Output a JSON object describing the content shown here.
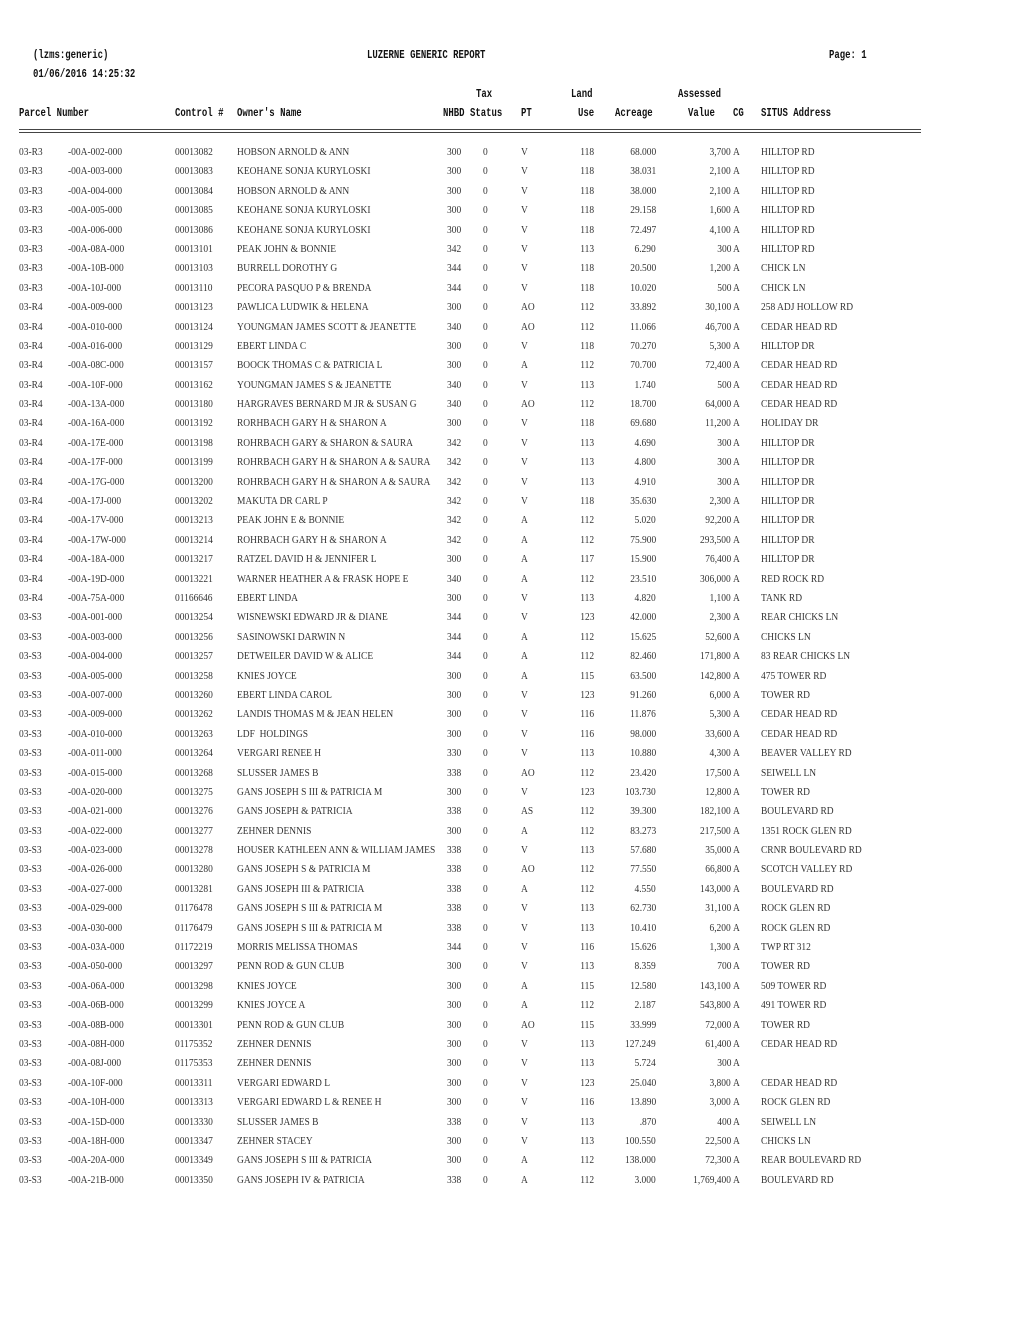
{
  "report": {
    "program": "(lzms:generic)",
    "title": "LUZERNE GENERIC REPORT",
    "page_label": "Page:",
    "page_number": "1",
    "run_datetime": "01/06/2016 14:25:32"
  },
  "columns": {
    "parcel_number": "Parcel Number",
    "control": "Control #",
    "owner": "Owner's Name",
    "nhbd": "NHBD",
    "tax_status_top": "Tax",
    "tax_status": "Status",
    "pt": "PT",
    "land_use_top": "Land",
    "land_use": "Use",
    "acreage": "Acreage",
    "assessed_value_top": "Assessed",
    "assessed_value": "Value",
    "cg": "CG",
    "situs": "SITUS Address"
  },
  "rows": [
    {
      "map": "03-R3",
      "parcel": "-00A-002-000",
      "control": "00013082",
      "owner": "HOBSON ARNOLD & ANN",
      "nhbd": "300",
      "status": "0",
      "pt": "V",
      "land_use": "118",
      "acreage": "68.000",
      "value": "3,700",
      "cg": "A",
      "situs": "HILLTOP RD"
    },
    {
      "map": "03-R3",
      "parcel": "-00A-003-000",
      "control": "00013083",
      "owner": "KEOHANE SONJA KURYLOSKI",
      "nhbd": "300",
      "status": "0",
      "pt": "V",
      "land_use": "118",
      "acreage": "38.031",
      "value": "2,100",
      "cg": "A",
      "situs": "HILLTOP RD"
    },
    {
      "map": "03-R3",
      "parcel": "-00A-004-000",
      "control": "00013084",
      "owner": "HOBSON ARNOLD & ANN",
      "nhbd": "300",
      "status": "0",
      "pt": "V",
      "land_use": "118",
      "acreage": "38.000",
      "value": "2,100",
      "cg": "A",
      "situs": "HILLTOP RD"
    },
    {
      "map": "03-R3",
      "parcel": "-00A-005-000",
      "control": "00013085",
      "owner": "KEOHANE SONJA KURYLOSKI",
      "nhbd": "300",
      "status": "0",
      "pt": "V",
      "land_use": "118",
      "acreage": "29.158",
      "value": "1,600",
      "cg": "A",
      "situs": "HILLTOP RD"
    },
    {
      "map": "03-R3",
      "parcel": "-00A-006-000",
      "control": "00013086",
      "owner": "KEOHANE SONJA KURYLOSKI",
      "nhbd": "300",
      "status": "0",
      "pt": "V",
      "land_use": "118",
      "acreage": "72.497",
      "value": "4,100",
      "cg": "A",
      "situs": "HILLTOP RD"
    },
    {
      "map": "03-R3",
      "parcel": "-00A-08A-000",
      "control": "00013101",
      "owner": "PEAK JOHN & BONNIE",
      "nhbd": "342",
      "status": "0",
      "pt": "V",
      "land_use": "113",
      "acreage": "6.290",
      "value": "300",
      "cg": "A",
      "situs": "HILLTOP RD"
    },
    {
      "map": "03-R3",
      "parcel": "-00A-10B-000",
      "control": "00013103",
      "owner": "BURRELL DOROTHY G",
      "nhbd": "344",
      "status": "0",
      "pt": "V",
      "land_use": "118",
      "acreage": "20.500",
      "value": "1,200",
      "cg": "A",
      "situs": "CHICK LN"
    },
    {
      "map": "03-R3",
      "parcel": "-00A-10J-000",
      "control": "00013110",
      "owner": "PECORA PASQUO P & BRENDA",
      "nhbd": "344",
      "status": "0",
      "pt": "V",
      "land_use": "118",
      "acreage": "10.020",
      "value": "500",
      "cg": "A",
      "situs": "CHICK LN"
    },
    {
      "map": "03-R4",
      "parcel": "-00A-009-000",
      "control": "00013123",
      "owner": "PAWLICA LUDWIK & HELENA",
      "nhbd": "300",
      "status": "0",
      "pt": "AO",
      "land_use": "112",
      "acreage": "33.892",
      "value": "30,100",
      "cg": "A",
      "situs": "258 ADJ HOLLOW RD"
    },
    {
      "map": "03-R4",
      "parcel": "-00A-010-000",
      "control": "00013124",
      "owner": "YOUNGMAN JAMES SCOTT & JEANETTE",
      "nhbd": "340",
      "status": "0",
      "pt": "AO",
      "land_use": "112",
      "acreage": "11.066",
      "value": "46,700",
      "cg": "A",
      "situs": "CEDAR HEAD RD"
    },
    {
      "map": "03-R4",
      "parcel": "-00A-016-000",
      "control": "00013129",
      "owner": "EBERT LINDA C",
      "nhbd": "300",
      "status": "0",
      "pt": "V",
      "land_use": "118",
      "acreage": "70.270",
      "value": "5,300",
      "cg": "A",
      "situs": "HILLTOP DR"
    },
    {
      "map": "03-R4",
      "parcel": "-00A-08C-000",
      "control": "00013157",
      "owner": "BOOCK THOMAS C & PATRICIA L",
      "nhbd": "300",
      "status": "0",
      "pt": "A",
      "land_use": "112",
      "acreage": "70.700",
      "value": "72,400",
      "cg": "A",
      "situs": "CEDAR HEAD RD"
    },
    {
      "map": "03-R4",
      "parcel": "-00A-10F-000",
      "control": "00013162",
      "owner": "YOUNGMAN JAMES S & JEANETTE",
      "nhbd": "340",
      "status": "0",
      "pt": "V",
      "land_use": "113",
      "acreage": "1.740",
      "value": "500",
      "cg": "A",
      "situs": "CEDAR HEAD RD"
    },
    {
      "map": "03-R4",
      "parcel": "-00A-13A-000",
      "control": "00013180",
      "owner": "HARGRAVES BERNARD M JR & SUSAN G",
      "nhbd": "340",
      "status": "0",
      "pt": "AO",
      "land_use": "112",
      "acreage": "18.700",
      "value": "64,000",
      "cg": "A",
      "situs": "CEDAR HEAD RD"
    },
    {
      "map": "03-R4",
      "parcel": "-00A-16A-000",
      "control": "00013192",
      "owner": "RORHBACH GARY H & SHARON A",
      "nhbd": "300",
      "status": "0",
      "pt": "V",
      "land_use": "118",
      "acreage": "69.680",
      "value": "11,200",
      "cg": "A",
      "situs": "HOLIDAY DR"
    },
    {
      "map": "03-R4",
      "parcel": "-00A-17E-000",
      "control": "00013198",
      "owner": "ROHRBACH GARY & SHARON & SAURA",
      "nhbd": "342",
      "status": "0",
      "pt": "V",
      "land_use": "113",
      "acreage": "4.690",
      "value": "300",
      "cg": "A",
      "situs": "HILLTOP DR"
    },
    {
      "map": "03-R4",
      "parcel": "-00A-17F-000",
      "control": "00013199",
      "owner": "ROHRBACH GARY H & SHARON A & SAURA",
      "nhbd": "342",
      "status": "0",
      "pt": "V",
      "land_use": "113",
      "acreage": "4.800",
      "value": "300",
      "cg": "A",
      "situs": "HILLTOP DR"
    },
    {
      "map": "03-R4",
      "parcel": "-00A-17G-000",
      "control": "00013200",
      "owner": "ROHRBACH GARY H & SHARON A & SAURA",
      "nhbd": "342",
      "status": "0",
      "pt": "V",
      "land_use": "113",
      "acreage": "4.910",
      "value": "300",
      "cg": "A",
      "situs": "HILLTOP DR"
    },
    {
      "map": "03-R4",
      "parcel": "-00A-17J-000",
      "control": "00013202",
      "owner": "MAKUTA DR CARL P",
      "nhbd": "342",
      "status": "0",
      "pt": "V",
      "land_use": "118",
      "acreage": "35.630",
      "value": "2,300",
      "cg": "A",
      "situs": "HILLTOP DR"
    },
    {
      "map": "03-R4",
      "parcel": "-00A-17V-000",
      "control": "00013213",
      "owner": "PEAK JOHN E & BONNIE",
      "nhbd": "342",
      "status": "0",
      "pt": "A",
      "land_use": "112",
      "acreage": "5.020",
      "value": "92,200",
      "cg": "A",
      "situs": "HILLTOP DR"
    },
    {
      "map": "03-R4",
      "parcel": "-00A-17W-000",
      "control": "00013214",
      "owner": "ROHRBACH GARY H & SHARON A",
      "nhbd": "342",
      "status": "0",
      "pt": "A",
      "land_use": "112",
      "acreage": "75.900",
      "value": "293,500",
      "cg": "A",
      "situs": "HILLTOP DR"
    },
    {
      "map": "03-R4",
      "parcel": "-00A-18A-000",
      "control": "00013217",
      "owner": "RATZEL DAVID H & JENNIFER L",
      "nhbd": "300",
      "status": "0",
      "pt": "A",
      "land_use": "117",
      "acreage": "15.900",
      "value": "76,400",
      "cg": "A",
      "situs": "HILLTOP DR"
    },
    {
      "map": "03-R4",
      "parcel": "-00A-19D-000",
      "control": "00013221",
      "owner": "WARNER HEATHER A & FRASK HOPE E",
      "nhbd": "340",
      "status": "0",
      "pt": "A",
      "land_use": "112",
      "acreage": "23.510",
      "value": "306,000",
      "cg": "A",
      "situs": "RED ROCK RD"
    },
    {
      "map": "03-R4",
      "parcel": "-00A-75A-000",
      "control": "01166646",
      "owner": "EBERT LINDA",
      "nhbd": "300",
      "status": "0",
      "pt": "V",
      "land_use": "113",
      "acreage": "4.820",
      "value": "1,100",
      "cg": "A",
      "situs": "TANK RD"
    },
    {
      "map": "03-S3",
      "parcel": "-00A-001-000",
      "control": "00013254",
      "owner": "WISNEWSKI EDWARD JR & DIANE",
      "nhbd": "344",
      "status": "0",
      "pt": "V",
      "land_use": "123",
      "acreage": "42.000",
      "value": "2,300",
      "cg": "A",
      "situs": "REAR CHICKS LN"
    },
    {
      "map": "03-S3",
      "parcel": "-00A-003-000",
      "control": "00013256",
      "owner": "SASINOWSKI DARWIN N",
      "nhbd": "344",
      "status": "0",
      "pt": "A",
      "land_use": "112",
      "acreage": "15.625",
      "value": "52,600",
      "cg": "A",
      "situs": "CHICKS LN"
    },
    {
      "map": "03-S3",
      "parcel": "-00A-004-000",
      "control": "00013257",
      "owner": "DETWEILER DAVID W & ALICE",
      "nhbd": "344",
      "status": "0",
      "pt": "A",
      "land_use": "112",
      "acreage": "82.460",
      "value": "171,800",
      "cg": "A",
      "situs": "83 REAR CHICKS LN"
    },
    {
      "map": "03-S3",
      "parcel": "-00A-005-000",
      "control": "00013258",
      "owner": "KNIES JOYCE",
      "nhbd": "300",
      "status": "0",
      "pt": "A",
      "land_use": "115",
      "acreage": "63.500",
      "value": "142,800",
      "cg": "A",
      "situs": "475 TOWER RD"
    },
    {
      "map": "03-S3",
      "parcel": "-00A-007-000",
      "control": "00013260",
      "owner": "EBERT LINDA CAROL",
      "nhbd": "300",
      "status": "0",
      "pt": "V",
      "land_use": "123",
      "acreage": "91.260",
      "value": "6,000",
      "cg": "A",
      "situs": "TOWER RD"
    },
    {
      "map": "03-S3",
      "parcel": "-00A-009-000",
      "control": "00013262",
      "owner": "LANDIS THOMAS M & JEAN HELEN",
      "nhbd": "300",
      "status": "0",
      "pt": "V",
      "land_use": "116",
      "acreage": "11.876",
      "value": "5,300",
      "cg": "A",
      "situs": "CEDAR HEAD RD"
    },
    {
      "map": "03-S3",
      "parcel": "-00A-010-000",
      "control": "00013263",
      "owner": "LDF  HOLDINGS",
      "nhbd": "300",
      "status": "0",
      "pt": "V",
      "land_use": "116",
      "acreage": "98.000",
      "value": "33,600",
      "cg": "A",
      "situs": "CEDAR HEAD RD"
    },
    {
      "map": "03-S3",
      "parcel": "-00A-011-000",
      "control": "00013264",
      "owner": "VERGARI RENEE H",
      "nhbd": "330",
      "status": "0",
      "pt": "V",
      "land_use": "113",
      "acreage": "10.880",
      "value": "4,300",
      "cg": "A",
      "situs": "BEAVER VALLEY RD"
    },
    {
      "map": "03-S3",
      "parcel": "-00A-015-000",
      "control": "00013268",
      "owner": "SLUSSER JAMES B",
      "nhbd": "338",
      "status": "0",
      "pt": "AO",
      "land_use": "112",
      "acreage": "23.420",
      "value": "17,500",
      "cg": "A",
      "situs": "SEIWELL LN"
    },
    {
      "map": "03-S3",
      "parcel": "-00A-020-000",
      "control": "00013275",
      "owner": "GANS JOSEPH S III & PATRICIA M",
      "nhbd": "300",
      "status": "0",
      "pt": "V",
      "land_use": "123",
      "acreage": "103.730",
      "value": "12,800",
      "cg": "A",
      "situs": "TOWER RD"
    },
    {
      "map": "03-S3",
      "parcel": "-00A-021-000",
      "control": "00013276",
      "owner": "GANS JOSEPH & PATRICIA",
      "nhbd": "338",
      "status": "0",
      "pt": "AS",
      "land_use": "112",
      "acreage": "39.300",
      "value": "182,100",
      "cg": "A",
      "situs": "BOULEVARD RD"
    },
    {
      "map": "03-S3",
      "parcel": "-00A-022-000",
      "control": "00013277",
      "owner": "ZEHNER DENNIS",
      "nhbd": "300",
      "status": "0",
      "pt": "A",
      "land_use": "112",
      "acreage": "83.273",
      "value": "217,500",
      "cg": "A",
      "situs": "1351 ROCK GLEN RD"
    },
    {
      "map": "03-S3",
      "parcel": "-00A-023-000",
      "control": "00013278",
      "owner": "HOUSER KATHLEEN ANN & WILLIAM JAMES",
      "nhbd": "338",
      "status": "0",
      "pt": "V",
      "land_use": "113",
      "acreage": "57.680",
      "value": "35,000",
      "cg": "A",
      "situs": "CRNR BOULEVARD RD"
    },
    {
      "map": "03-S3",
      "parcel": "-00A-026-000",
      "control": "00013280",
      "owner": "GANS JOSEPH S & PATRICIA M",
      "nhbd": "338",
      "status": "0",
      "pt": "AO",
      "land_use": "112",
      "acreage": "77.550",
      "value": "66,800",
      "cg": "A",
      "situs": "SCOTCH VALLEY RD"
    },
    {
      "map": "03-S3",
      "parcel": "-00A-027-000",
      "control": "00013281",
      "owner": "GANS JOSEPH III & PATRICIA",
      "nhbd": "338",
      "status": "0",
      "pt": "A",
      "land_use": "112",
      "acreage": "4.550",
      "value": "143,000",
      "cg": "A",
      "situs": "BOULEVARD RD"
    },
    {
      "map": "03-S3",
      "parcel": "-00A-029-000",
      "control": "01176478",
      "owner": "GANS JOSEPH S III & PATRICIA M",
      "nhbd": "338",
      "status": "0",
      "pt": "V",
      "land_use": "113",
      "acreage": "62.730",
      "value": "31,100",
      "cg": "A",
      "situs": "ROCK GLEN RD"
    },
    {
      "map": "03-S3",
      "parcel": "-00A-030-000",
      "control": "01176479",
      "owner": "GANS JOSEPH S III & PATRICIA M",
      "nhbd": "338",
      "status": "0",
      "pt": "V",
      "land_use": "113",
      "acreage": "10.410",
      "value": "6,200",
      "cg": "A",
      "situs": "ROCK GLEN RD"
    },
    {
      "map": "03-S3",
      "parcel": "-00A-03A-000",
      "control": "01172219",
      "owner": "MORRIS MELISSA THOMAS",
      "nhbd": "344",
      "status": "0",
      "pt": "V",
      "land_use": "116",
      "acreage": "15.626",
      "value": "1,300",
      "cg": "A",
      "situs": "TWP RT 312"
    },
    {
      "map": "03-S3",
      "parcel": "-00A-050-000",
      "control": "00013297",
      "owner": "PENN ROD & GUN CLUB",
      "nhbd": "300",
      "status": "0",
      "pt": "V",
      "land_use": "113",
      "acreage": "8.359",
      "value": "700",
      "cg": "A",
      "situs": "TOWER RD"
    },
    {
      "map": "03-S3",
      "parcel": "-00A-06A-000",
      "control": "00013298",
      "owner": "KNIES JOYCE",
      "nhbd": "300",
      "status": "0",
      "pt": "A",
      "land_use": "115",
      "acreage": "12.580",
      "value": "143,100",
      "cg": "A",
      "situs": "509 TOWER RD"
    },
    {
      "map": "03-S3",
      "parcel": "-00A-06B-000",
      "control": "00013299",
      "owner": "KNIES JOYCE A",
      "nhbd": "300",
      "status": "0",
      "pt": "A",
      "land_use": "112",
      "acreage": "2.187",
      "value": "543,800",
      "cg": "A",
      "situs": "491 TOWER RD"
    },
    {
      "map": "03-S3",
      "parcel": "-00A-08B-000",
      "control": "00013301",
      "owner": "PENN ROD & GUN CLUB",
      "nhbd": "300",
      "status": "0",
      "pt": "AO",
      "land_use": "115",
      "acreage": "33.999",
      "value": "72,000",
      "cg": "A",
      "situs": "TOWER RD"
    },
    {
      "map": "03-S3",
      "parcel": "-00A-08H-000",
      "control": "01175352",
      "owner": "ZEHNER DENNIS",
      "nhbd": "300",
      "status": "0",
      "pt": "V",
      "land_use": "113",
      "acreage": "127.249",
      "value": "61,400",
      "cg": "A",
      "situs": "CEDAR HEAD RD"
    },
    {
      "map": "03-S3",
      "parcel": "-00A-08J-000",
      "control": "01175353",
      "owner": "ZEHNER DENNIS",
      "nhbd": "300",
      "status": "0",
      "pt": "V",
      "land_use": "113",
      "acreage": "5.724",
      "value": "300",
      "cg": "A",
      "situs": ""
    },
    {
      "map": "03-S3",
      "parcel": "-00A-10F-000",
      "control": "00013311",
      "owner": "VERGARI EDWARD L",
      "nhbd": "300",
      "status": "0",
      "pt": "V",
      "land_use": "123",
      "acreage": "25.040",
      "value": "3,800",
      "cg": "A",
      "situs": "CEDAR HEAD RD"
    },
    {
      "map": "03-S3",
      "parcel": "-00A-10H-000",
      "control": "00013313",
      "owner": "VERGARI EDWARD L & RENEE H",
      "nhbd": "300",
      "status": "0",
      "pt": "V",
      "land_use": "116",
      "acreage": "13.890",
      "value": "3,000",
      "cg": "A",
      "situs": "ROCK GLEN RD"
    },
    {
      "map": "03-S3",
      "parcel": "-00A-15D-000",
      "control": "00013330",
      "owner": "SLUSSER JAMES B",
      "nhbd": "338",
      "status": "0",
      "pt": "V",
      "land_use": "113",
      "acreage": ".870",
      "value": "400",
      "cg": "A",
      "situs": "SEIWELL LN"
    },
    {
      "map": "03-S3",
      "parcel": "-00A-18H-000",
      "control": "00013347",
      "owner": "ZEHNER STACEY",
      "nhbd": "300",
      "status": "0",
      "pt": "V",
      "land_use": "113",
      "acreage": "100.550",
      "value": "22,500",
      "cg": "A",
      "situs": "CHICKS LN"
    },
    {
      "map": "03-S3",
      "parcel": "-00A-20A-000",
      "control": "00013349",
      "owner": "GANS JOSEPH S III & PATRICIA",
      "nhbd": "300",
      "status": "0",
      "pt": "A",
      "land_use": "112",
      "acreage": "138.000",
      "value": "72,300",
      "cg": "A",
      "situs": "REAR BOULEVARD RD"
    },
    {
      "map": "03-S3",
      "parcel": "-00A-21B-000",
      "control": "00013350",
      "owner": "GANS JOSEPH IV & PATRICIA",
      "nhbd": "338",
      "status": "0",
      "pt": "A",
      "land_use": "112",
      "acreage": "3.000",
      "value": "1,769,400",
      "cg": "A",
      "situs": "BOULEVARD RD"
    }
  ]
}
